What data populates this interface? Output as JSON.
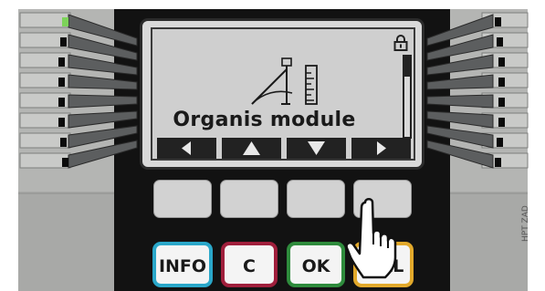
{
  "display": {
    "title": "Organis module"
  },
  "navigation": {
    "left_icon": "arrow-left-icon",
    "up_icon": "arrow-up-icon",
    "down_icon": "arrow-down-icon",
    "right_icon": "arrow-right-icon"
  },
  "function_keys": [
    {
      "label": "INFO",
      "color": "#2aa7c9"
    },
    {
      "label": "C",
      "color": "#a01f3c"
    },
    {
      "label": "OK",
      "color": "#2e8b3c"
    },
    {
      "label": "CTRL",
      "visible_text": "RL",
      "color": "#e2a92b"
    }
  ],
  "watermark": "HPT ZAD",
  "colors": {
    "housing": "#111111",
    "side_panel": "#a9aaa8",
    "lcd_background": "#cfcfcf",
    "led_green": "#7dd35a"
  }
}
